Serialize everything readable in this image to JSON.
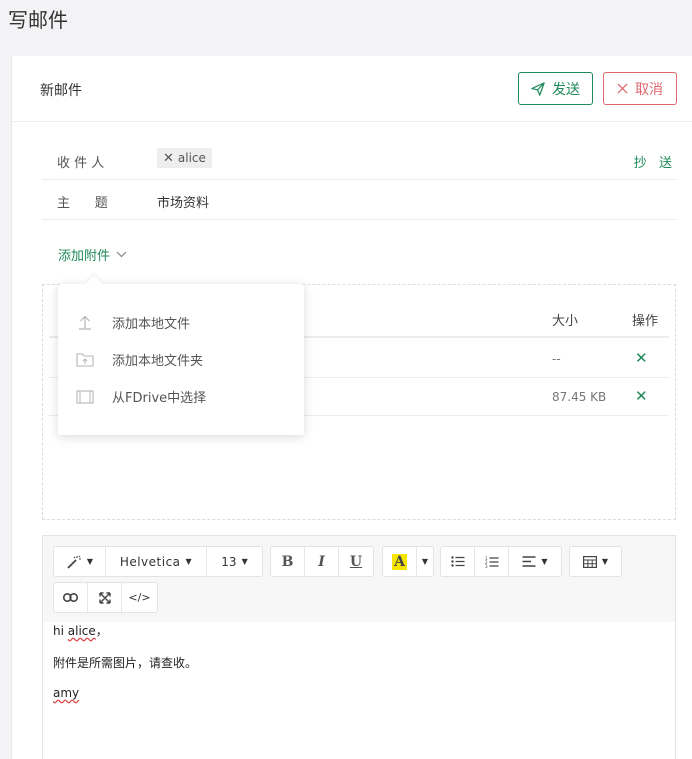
{
  "page_title": "写邮件",
  "header": {
    "title": "新邮件",
    "send_label": "发送",
    "cancel_label": "取消"
  },
  "recipients": {
    "label": "收 件 人",
    "tags": [
      "alice"
    ],
    "cc_label": "抄   送"
  },
  "subject": {
    "label": "主      题",
    "value": "市场资料"
  },
  "attachments": {
    "add_label": "添加附件",
    "columns": {
      "size": "大小",
      "action": "操作"
    },
    "rows": [
      {
        "size": "--"
      },
      {
        "size": "87.45 KB"
      }
    ],
    "menu": [
      {
        "label": "添加本地文件",
        "icon": "upload-icon"
      },
      {
        "label": "添加本地文件夹",
        "icon": "folder-upload-icon"
      },
      {
        "label": "从FDrive中选择",
        "icon": "drive-icon"
      }
    ]
  },
  "toolbar": {
    "font_family": "Helvetica",
    "font_size": "13",
    "bold": "B",
    "italic": "I",
    "underline": "U",
    "highlight": "A",
    "highlight_color": "#f5e500",
    "code": "</>"
  },
  "body": {
    "greeting_prefix": "hi ",
    "greeting_name": "alice",
    "greeting_suffix": "，",
    "line2": "附件是所需图片，请查收。",
    "signature": "amy"
  },
  "colors": {
    "accent": "#1e8a5a",
    "danger": "#e0676f"
  }
}
